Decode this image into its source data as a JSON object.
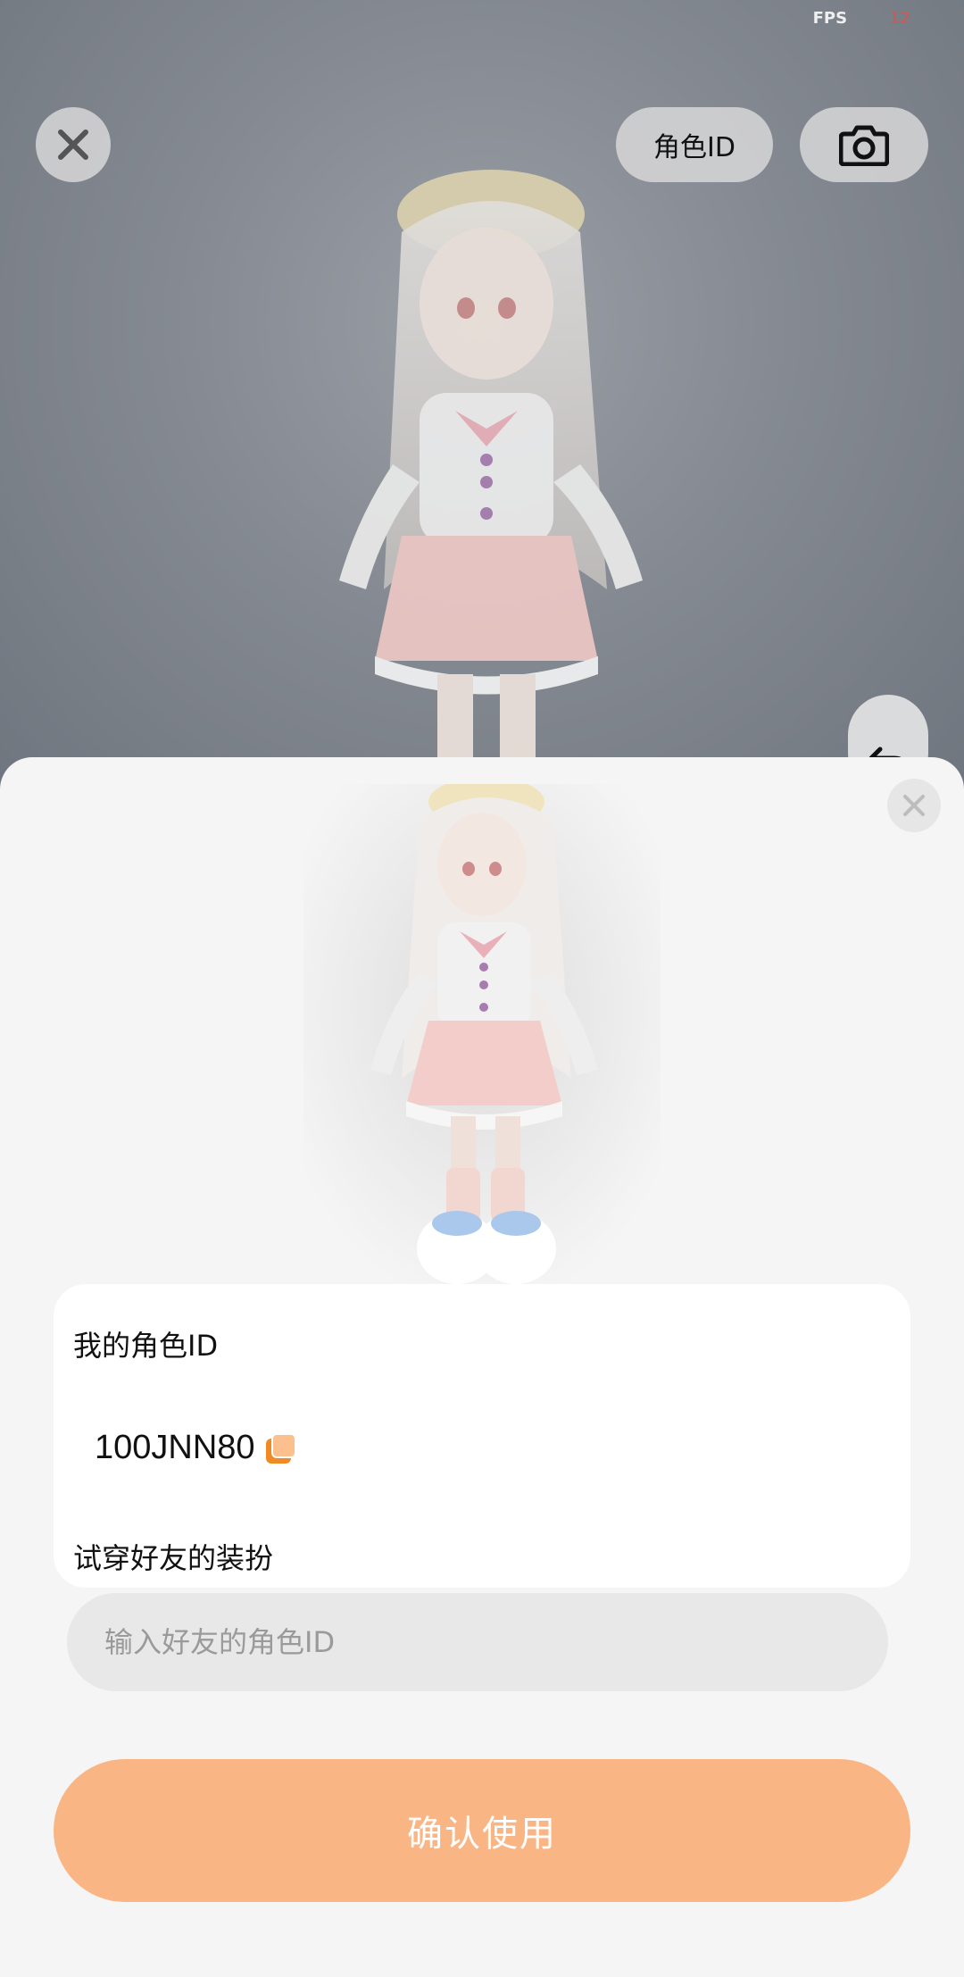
{
  "status": {
    "fps_label": "FPS",
    "fps_value": "12"
  },
  "scene": {
    "role_id_button": "角色ID",
    "icons": {
      "close": "close-icon",
      "camera": "camera-icon",
      "undo": "undo-icon"
    }
  },
  "sheet": {
    "my_role_id_label": "我的角色ID",
    "my_role_id_value": "100JNN80",
    "tryon_label": "试穿好友的装扮",
    "friend_id_input": {
      "placeholder": "输入好友的角色ID",
      "value": ""
    },
    "confirm_button": "确认使用",
    "icons": {
      "close": "close-icon",
      "copy": "copy-icon"
    }
  },
  "colors": {
    "accent": "#fab585",
    "copy_icon": "#f08a24",
    "fps_value": "#d9534f"
  }
}
